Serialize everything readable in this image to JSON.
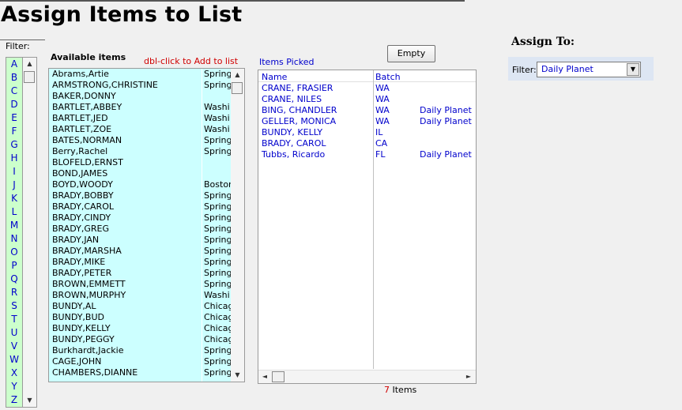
{
  "title": "Assign Items to List",
  "filter_label": "Filter:",
  "alphabet": [
    "A",
    "B",
    "C",
    "D",
    "E",
    "F",
    "G",
    "H",
    "I",
    "J",
    "K",
    "L",
    "M",
    "N",
    "O",
    "P",
    "Q",
    "R",
    "S",
    "T",
    "U",
    "V",
    "W",
    "X",
    "Y",
    "Z"
  ],
  "available": {
    "label": "Available items",
    "hint": "dbl-click to Add to list",
    "items": [
      {
        "name": "Abrams,Artie",
        "city": "Spring"
      },
      {
        "name": "ARMSTRONG,CHRISTINE",
        "city": "Spring"
      },
      {
        "name": "BAKER,DONNY",
        "city": ""
      },
      {
        "name": "BARTLET,ABBEY",
        "city": "Washi"
      },
      {
        "name": "BARTLET,JED",
        "city": "Washi"
      },
      {
        "name": "BARTLET,ZOE",
        "city": "Washi"
      },
      {
        "name": "BATES,NORMAN",
        "city": "Spring"
      },
      {
        "name": "Berry,Rachel",
        "city": "Spring"
      },
      {
        "name": "BLOFELD,ERNST",
        "city": ""
      },
      {
        "name": "BOND,JAMES",
        "city": ""
      },
      {
        "name": "BOYD,WOODY",
        "city": "Boston"
      },
      {
        "name": "BRADY,BOBBY",
        "city": "Spring"
      },
      {
        "name": "BRADY,CAROL",
        "city": "Spring"
      },
      {
        "name": "BRADY,CINDY",
        "city": "Spring"
      },
      {
        "name": "BRADY,GREG",
        "city": "Spring"
      },
      {
        "name": "BRADY,JAN",
        "city": "Spring"
      },
      {
        "name": "BRADY,MARSHA",
        "city": "Spring"
      },
      {
        "name": "BRADY,MIKE",
        "city": "Spring"
      },
      {
        "name": "BRADY,PETER",
        "city": "Spring"
      },
      {
        "name": "BROWN,EMMETT",
        "city": "Spring"
      },
      {
        "name": "BROWN,MURPHY",
        "city": "Washi"
      },
      {
        "name": "BUNDY,AL",
        "city": "Chicag"
      },
      {
        "name": "BUNDY,BUD",
        "city": "Chicag"
      },
      {
        "name": "BUNDY,KELLY",
        "city": "Chicag"
      },
      {
        "name": "BUNDY,PEGGY",
        "city": "Chicag"
      },
      {
        "name": "Burkhardt,Jackie",
        "city": "Spring"
      },
      {
        "name": "CAGE,JOHN",
        "city": "Spring"
      },
      {
        "name": "CHAMBERS,DIANNE",
        "city": "Spring"
      }
    ]
  },
  "picked": {
    "label": "Items Picked",
    "empty_button": "Empty",
    "columns": {
      "name": "Name",
      "batch": "Batch"
    },
    "rows": [
      {
        "name": "CRANE, FRASIER",
        "batch": "WA",
        "assign": ""
      },
      {
        "name": "CRANE, NILES",
        "batch": "WA",
        "assign": ""
      },
      {
        "name": "BING, CHANDLER",
        "batch": "WA",
        "assign": "Daily Planet"
      },
      {
        "name": "GELLER, MONICA",
        "batch": "WA",
        "assign": "Daily Planet"
      },
      {
        "name": "BUNDY, KELLY",
        "batch": "IL",
        "assign": ""
      },
      {
        "name": "BRADY, CAROL",
        "batch": "CA",
        "assign": ""
      },
      {
        "name": "Tubbs, Ricardo",
        "batch": "FL",
        "assign": "Daily Planet"
      }
    ],
    "count": "7",
    "count_suffix": "Items"
  },
  "assign_to": {
    "title": "Assign To:",
    "filter_label": "Filter:",
    "selected": "Daily Planet"
  },
  "icons": {
    "up": "▲",
    "down": "▼",
    "left": "◄",
    "right": "►",
    "dropdown": "▼"
  }
}
